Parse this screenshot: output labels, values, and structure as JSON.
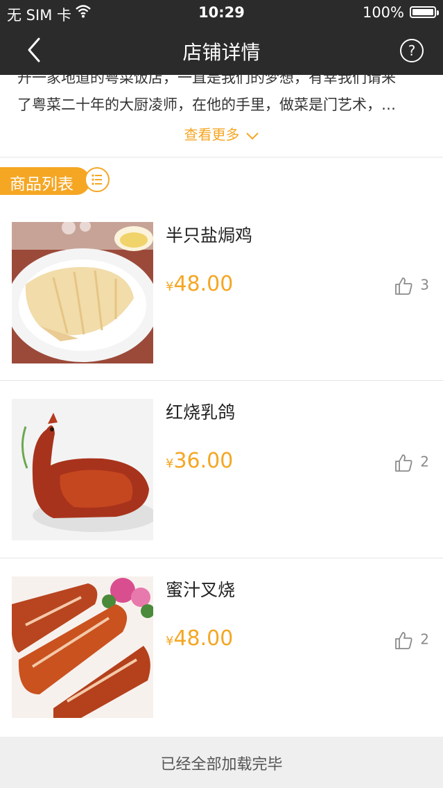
{
  "status_bar": {
    "carrier": "无 SIM 卡",
    "time": "10:29",
    "battery": "100%"
  },
  "nav": {
    "title": "店铺详情",
    "help_glyph": "?"
  },
  "description": {
    "line1": "开一家地道的粤菜饭店，一直是我们的梦想，有幸我们请来",
    "line2": "了粤菜二十年的大厨凌师，在他的手里，做菜是门艺术，…",
    "more_label": "查看更多"
  },
  "section": {
    "label": "商品列表"
  },
  "items": [
    {
      "name": "半只盐焗鸡",
      "currency": "¥",
      "price": "48.00",
      "likes": "3"
    },
    {
      "name": "红烧乳鸽",
      "currency": "¥",
      "price": "36.00",
      "likes": "2"
    },
    {
      "name": "蜜汁叉烧",
      "currency": "¥",
      "price": "48.00",
      "likes": "2"
    }
  ],
  "footer": {
    "text": "已经全部加载完毕"
  },
  "colors": {
    "accent": "#f5a623",
    "nav_bg": "#2b2b2b",
    "footer_bg": "#efefef"
  }
}
